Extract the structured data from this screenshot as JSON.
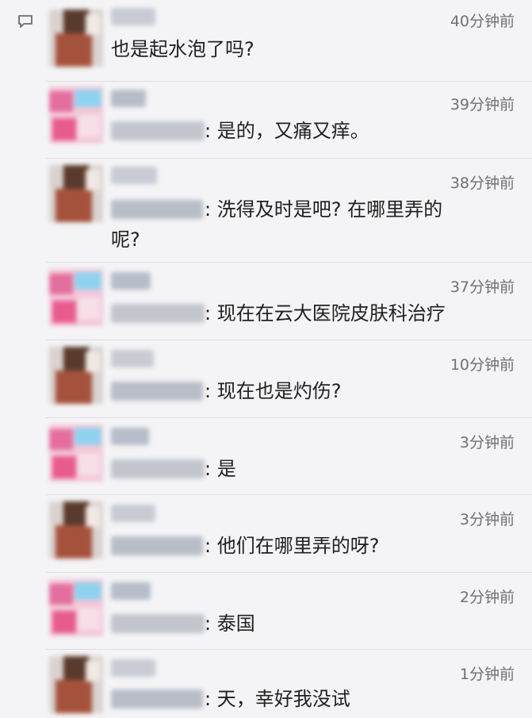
{
  "icons": {
    "comment": "comment-bubble-icon"
  },
  "comments": [
    {
      "time": "40分钟前",
      "text": "也是起水泡了吗?",
      "avatar": "photo"
    },
    {
      "time": "39分钟前",
      "text": ": 是的，又痛又痒。",
      "avatar": "pink"
    },
    {
      "time": "38分钟前",
      "text": ": 洗得及时是吧? 在哪里弄的",
      "text2": "呢?",
      "avatar": "photo"
    },
    {
      "time": "37分钟前",
      "text": ": 现在在云大医院皮肤科治疗",
      "avatar": "pink"
    },
    {
      "time": "10分钟前",
      "text": ": 现在也是灼伤?",
      "avatar": "photo"
    },
    {
      "time": "3分钟前",
      "text": ": 是",
      "avatar": "pink"
    },
    {
      "time": "3分钟前",
      "text": ": 他们在哪里弄的呀?",
      "avatar": "photo"
    },
    {
      "time": "2分钟前",
      "text": ": 泰国",
      "avatar": "pink"
    },
    {
      "time": "1分钟前",
      "text": ": 天，幸好我没试",
      "avatar": "photo"
    }
  ]
}
